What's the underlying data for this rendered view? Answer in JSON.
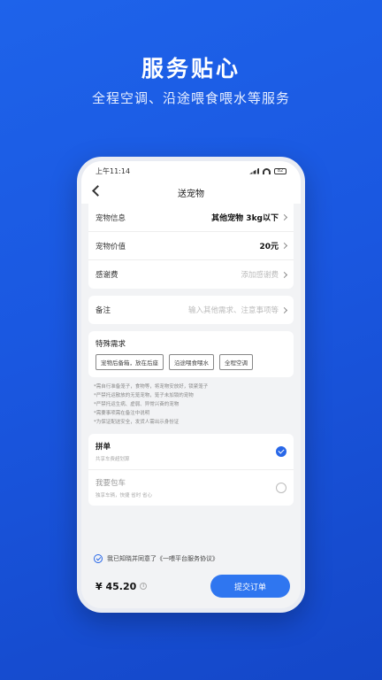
{
  "promo": {
    "headline": "服务贴心",
    "subline": "全程空调、沿途喂食喂水等服务"
  },
  "statusbar": {
    "time": "上午11:14",
    "battery": "82"
  },
  "nav": {
    "title": "送宠物"
  },
  "pet_card": {
    "rows": [
      {
        "label": "宠物信息",
        "value": "其他宠物 3kg以下"
      },
      {
        "label": "宠物价值",
        "value": "20元"
      },
      {
        "label": "感谢费",
        "placeholder": "添加感谢费"
      }
    ]
  },
  "remark": {
    "label": "备注",
    "placeholder": "输入其他需求、注意事项等"
  },
  "special": {
    "title": "特殊需求",
    "tags": [
      "宠物后备箱，放在后座",
      "沿途喂食喂水",
      "全程空调"
    ]
  },
  "notes": [
    "*需自行准备笼子，食物等，将宠物安放好，锁紧笼子",
    "*严禁托运散放的无笼宠物，笼子未加锁的宠物",
    "*严禁托运生病、虚弱、异常兴奋的宠物",
    "*需要事项需在备注中说明",
    "*为保证配送安全，发货人需出示身份证"
  ],
  "options": [
    {
      "title": "拼单",
      "sub": "共享车费超划算",
      "selected": true
    },
    {
      "title": "我要包车",
      "sub": "独享车辆，快捷 省时 省心",
      "selected": false
    }
  ],
  "agreement": {
    "text": "我已知晓并同意了《一喂平台服务协议》"
  },
  "footer": {
    "price": "¥ 45.20",
    "submit_label": "提交订单"
  },
  "colors": {
    "accent": "#2f76f0",
    "background": "#1a57e0"
  }
}
